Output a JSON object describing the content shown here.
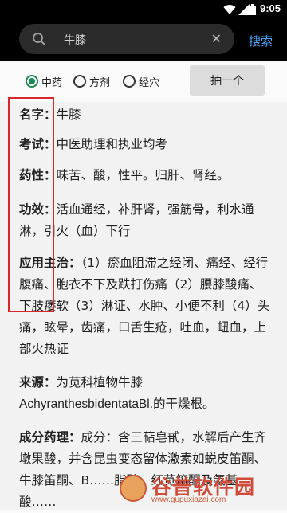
{
  "statusbar": {
    "time": "9:05"
  },
  "search": {
    "value": "牛膝",
    "clear_symbol": "✕",
    "button_label": "搜索"
  },
  "filters": {
    "options": [
      {
        "label": "中药",
        "checked": true
      },
      {
        "label": "方剂",
        "checked": false
      },
      {
        "label": "经穴",
        "checked": false
      }
    ],
    "random_button": "抽一个"
  },
  "entries": {
    "name": {
      "key": "名字",
      "value": "牛膝"
    },
    "exam": {
      "key": "考试",
      "value": "中医助理和执业均考"
    },
    "property": {
      "key": "药性",
      "value": "味苦、酸，性平。归肝、肾经。"
    },
    "efficacy": {
      "key": "功效",
      "value": "活血通经，补肝肾，强筋骨，利水通淋，引火（血）下行"
    },
    "indications": {
      "key": "应用主治",
      "value": "（1）瘀血阻滞之经闭、痛经、经行腹痛、胞衣不下及跌打伤痛（2）腰膝酸痛、下肢痿软（3）淋证、水肿、小便不利（4）头痛，眩晕，齿痛，口舌生疮，吐血，衄血，上部火热证"
    },
    "source": {
      "key": "来源",
      "value_zh": "为苋科植物牛膝",
      "value_latin": "AchyranthesbidentataBl.",
      "value_tail": "的干燥根。"
    },
    "pharmacology": {
      "key": "成分药理",
      "value": "成分：含三萜皂甙，水解后产生齐墩果酸，并含昆虫变态留体激素如蜕皮笛酮、牛膝笛酮、B……脂醇、红苋笛酮及氨基酸……"
    }
  },
  "watermark": {
    "logo": "谷普软件园",
    "url": "www.gupuxiazai.com"
  },
  "colors": {
    "accent_green": "#1a8a57",
    "link_blue": "#4fa8ff",
    "highlight_red": "#d9262b"
  }
}
